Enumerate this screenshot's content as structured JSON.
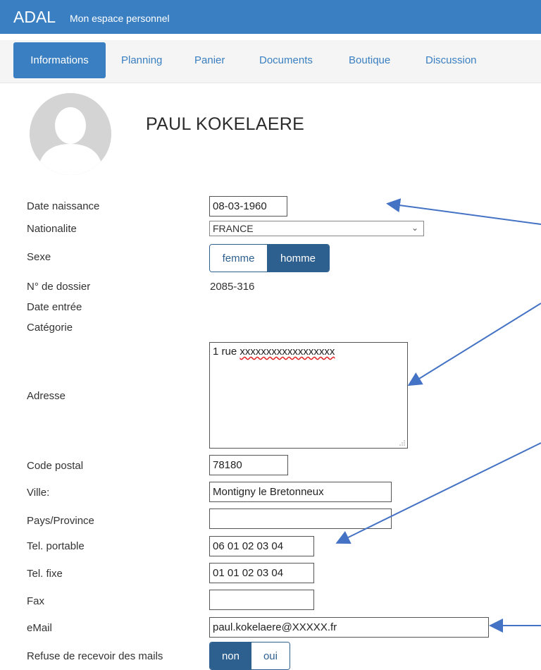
{
  "app": {
    "brand": "ADAL",
    "subtitle": "Mon espace personnel"
  },
  "nav": {
    "tabs": [
      {
        "label": "Informations",
        "active": true
      },
      {
        "label": "Planning"
      },
      {
        "label": "Panier"
      },
      {
        "label": "Documents"
      },
      {
        "label": "Boutique"
      },
      {
        "label": "Discussion"
      }
    ]
  },
  "profile": {
    "name": "PAUL KOKELAERE",
    "avatar_icon": "user-silhouette-icon"
  },
  "form": {
    "birth_date": {
      "label": "Date naissance",
      "value": "08-03-1960"
    },
    "nationality": {
      "label": "Nationalite",
      "value": "FRANCE"
    },
    "sex": {
      "label": "Sexe",
      "options": [
        "femme",
        "homme"
      ],
      "selected": "homme"
    },
    "file_number": {
      "label": "N° de dossier",
      "value": "2085-316"
    },
    "entry_date": {
      "label": "Date entrée",
      "value": ""
    },
    "category": {
      "label": "Catégorie",
      "value": ""
    },
    "address": {
      "label": "Adresse",
      "value_prefix": "1 rue ",
      "value_misspelled": "xxxxxxxxxxxxxxxxxx"
    },
    "postal_code": {
      "label": "Code postal",
      "value": "78180"
    },
    "city": {
      "label": "Ville:",
      "value": "Montigny le Bretonneux"
    },
    "country": {
      "label": "Pays/Province",
      "value": ""
    },
    "mobile": {
      "label": "Tel. portable",
      "value": "06 01 02 03 04"
    },
    "landline": {
      "label": "Tel. fixe",
      "value": "01 01 02 03 04"
    },
    "fax": {
      "label": "Fax",
      "value": ""
    },
    "email": {
      "label": "eMail",
      "value": "paul.kokelaere@XXXXX.fr"
    },
    "refuse_mail": {
      "label": "Refuse de recevoir des mails",
      "options": [
        "non",
        "oui"
      ],
      "selected": "non"
    }
  },
  "colors": {
    "header": "#3a7fc1",
    "toggle_active": "#2d5f8f",
    "arrow": "#4472c4"
  }
}
